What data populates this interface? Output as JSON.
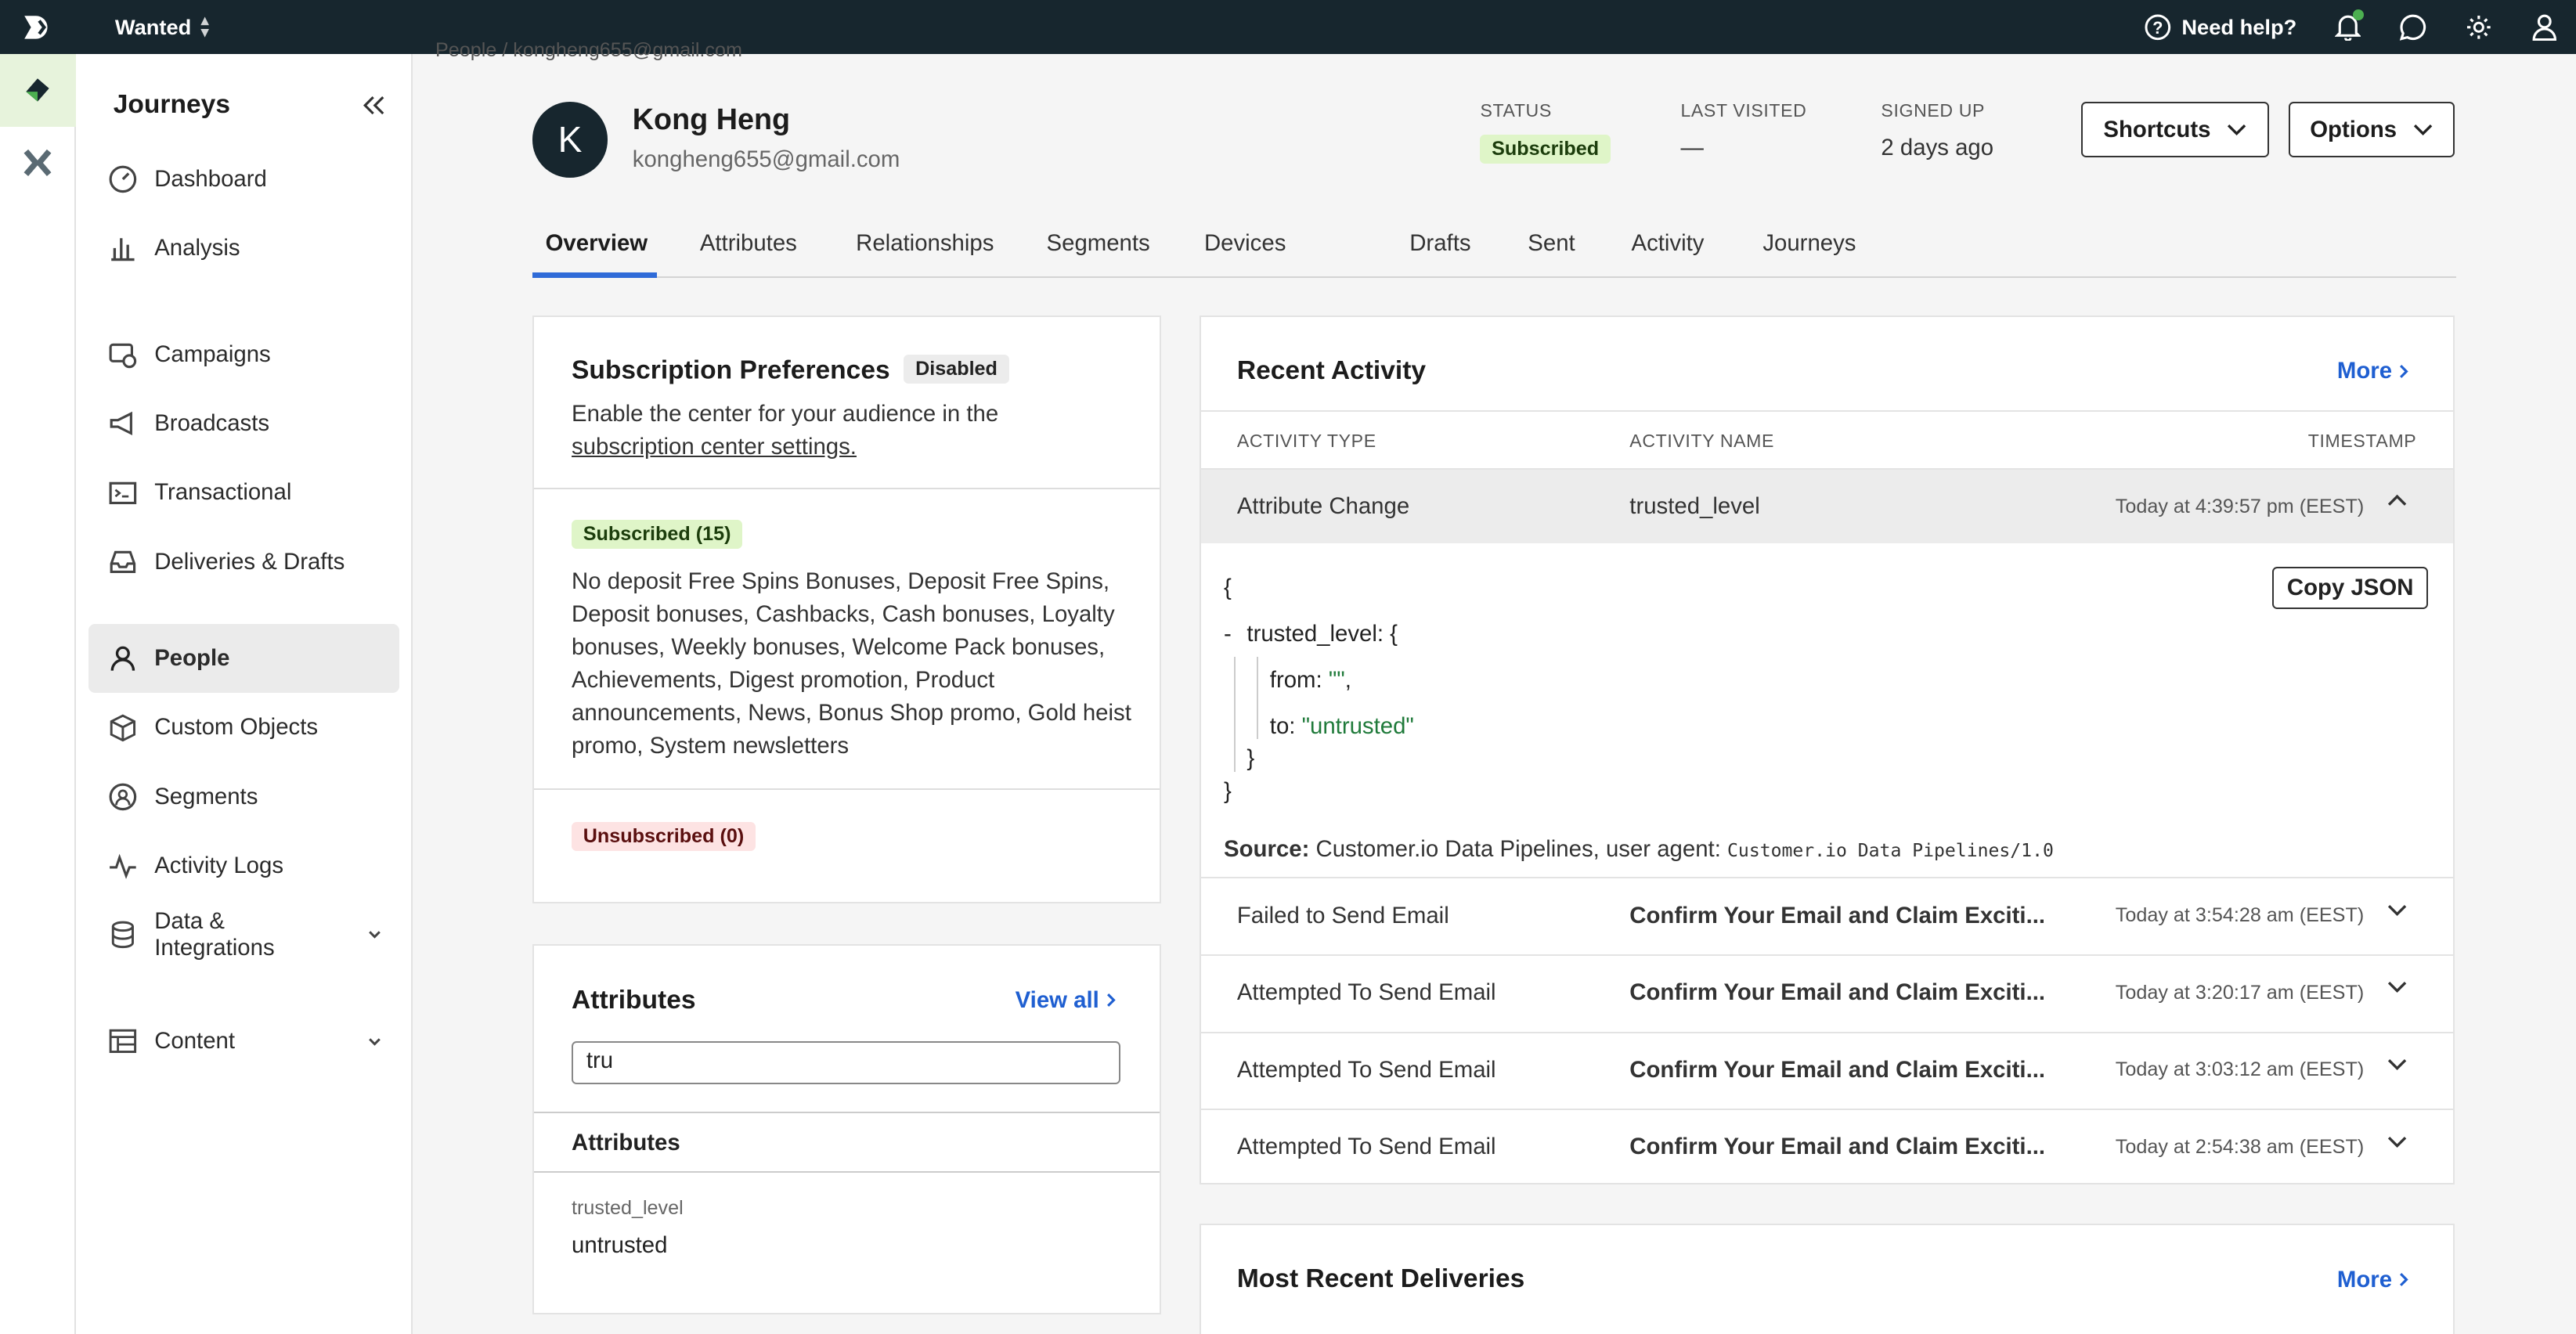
{
  "topbar": {
    "workspace": "Wanted",
    "help_label": "Need help?"
  },
  "sidebar": {
    "title": "Journeys",
    "items": [
      {
        "label": "Dashboard"
      },
      {
        "label": "Analysis"
      },
      {
        "label": "Campaigns"
      },
      {
        "label": "Broadcasts"
      },
      {
        "label": "Transactional"
      },
      {
        "label": "Deliveries & Drafts"
      },
      {
        "label": "People"
      },
      {
        "label": "Custom Objects"
      },
      {
        "label": "Segments"
      },
      {
        "label": "Activity Logs"
      },
      {
        "label": "Data & Integrations"
      },
      {
        "label": "Content"
      }
    ]
  },
  "profile": {
    "breadcrumb": "People / kongheng655@gmail.com",
    "avatar_letter": "K",
    "name": "Kong Heng",
    "email": "kongheng655@gmail.com",
    "status_label": "STATUS",
    "status_value": "Subscribed",
    "last_visited_label": "LAST VISITED",
    "last_visited_value": "—",
    "signed_up_label": "SIGNED UP",
    "signed_up_value": "2 days ago",
    "shortcuts_label": "Shortcuts",
    "options_label": "Options"
  },
  "tabs": [
    "Overview",
    "Attributes",
    "Relationships",
    "Segments",
    "Devices",
    "Drafts",
    "Sent",
    "Activity",
    "Journeys"
  ],
  "subscription": {
    "title": "Subscription Preferences",
    "status_badge": "Disabled",
    "desc": "Enable the center for your audience in the",
    "link": "subscription center settings.",
    "subscribed_badge": "Subscribed (15)",
    "subscribed_list": "No deposit Free Spins Bonuses, Deposit Free Spins, Deposit bonuses, Cashbacks, Cash bonuses, Loyalty bonuses, Weekly bonuses, Welcome Pack bonuses, Achievements, Digest promotion, Product announcements, News, Bonus Shop promo, Gold heist promo, System newsletters",
    "unsubscribed_badge": "Unsubscribed (0)"
  },
  "attributes": {
    "title": "Attributes",
    "view_all": "View all",
    "search_value": "tru",
    "section_label": "Attributes",
    "items": [
      {
        "name": "trusted_level",
        "value": "untrusted"
      }
    ]
  },
  "recent_activity": {
    "title": "Recent Activity",
    "more_label": "More",
    "col_type": "ACTIVITY TYPE",
    "col_name": "ACTIVITY NAME",
    "col_time": "TIMESTAMP",
    "expanded": {
      "type": "Attribute Change",
      "name": "trusted_level",
      "time": "Today at 4:39:57 pm (EEST)",
      "copy_label": "Copy JSON",
      "json_open": "{",
      "json_key": "trusted_level: {",
      "json_from_key": "from: ",
      "json_from_val": "\"\"",
      "json_from_tail": ",",
      "json_to_key": "to: ",
      "json_to_val": "\"untrusted\"",
      "json_inner_close": "}",
      "json_close": "}",
      "source_label": "Source:",
      "source_text": "Customer.io Data Pipelines, user agent:",
      "source_agent": "Customer.io Data Pipelines/1.0"
    },
    "rows": [
      {
        "type": "Failed to Send Email",
        "name": "Confirm Your Email and Claim Exciti...",
        "time": "Today at 3:54:28 am (EEST)"
      },
      {
        "type": "Attempted To Send Email",
        "name": "Confirm Your Email and Claim Exciti...",
        "time": "Today at 3:20:17 am (EEST)"
      },
      {
        "type": "Attempted To Send Email",
        "name": "Confirm Your Email and Claim Exciti...",
        "time": "Today at 3:03:12 am (EEST)"
      },
      {
        "type": "Attempted To Send Email",
        "name": "Confirm Your Email and Claim Exciti...",
        "time": "Today at 2:54:38 am (EEST)"
      }
    ]
  },
  "deliveries": {
    "title": "Most Recent Deliveries",
    "more_label": "More"
  },
  "colors": {
    "topbar": "#17262e",
    "accent": "#2f6bd8",
    "link": "#1f5fd1",
    "subscribed_bg": "#dff5c8",
    "unsubscribed_bg": "#fde3e3"
  }
}
